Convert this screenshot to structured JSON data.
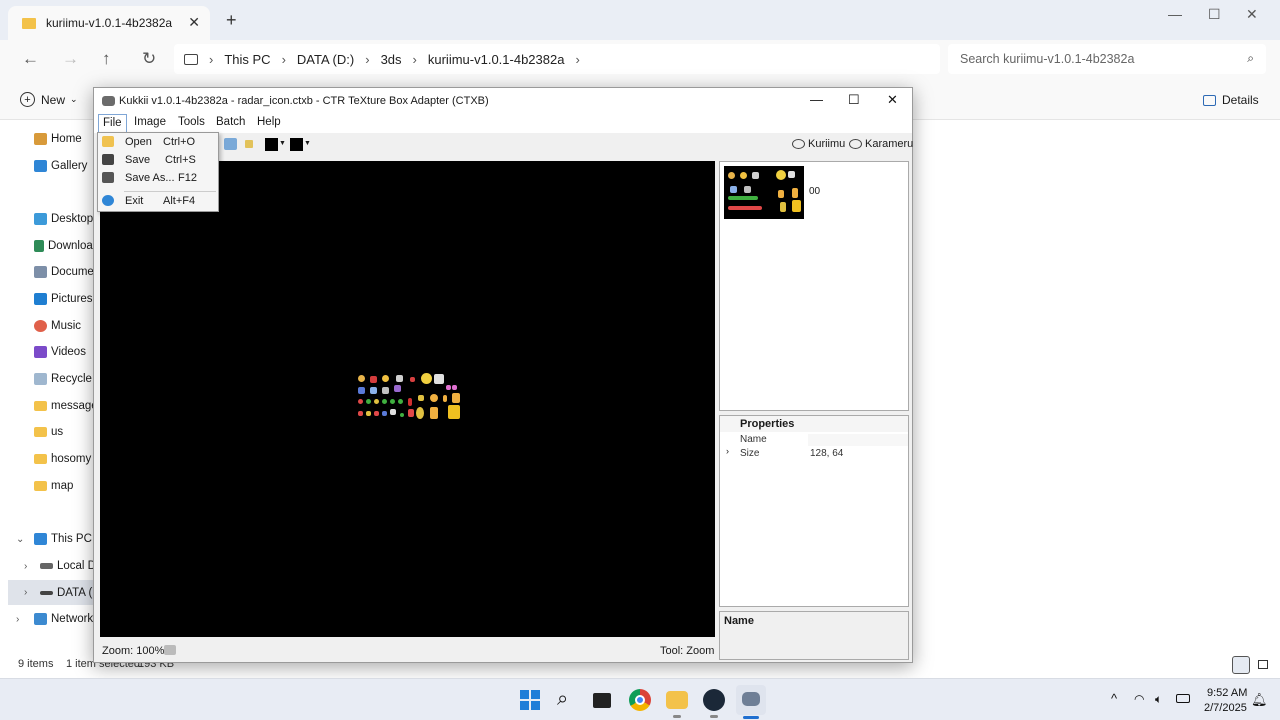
{
  "explorer": {
    "tab_title": "kuriimu-v1.0.1-4b2382a",
    "new_tab": "+",
    "window_controls": {
      "minimize": "—",
      "maximize": "☐",
      "close": "✕"
    },
    "nav_buttons": {
      "back": "←",
      "forward": "→",
      "up": "↑",
      "refresh": "↻"
    },
    "breadcrumb": [
      "This PC",
      "DATA (D:)",
      "3ds",
      "kuriimu-v1.0.1-4b2382a"
    ],
    "search_placeholder": "Search kuriimu-v1.0.1-4b2382a",
    "new_label": "New",
    "details_label": "Details",
    "sidebar": [
      {
        "label": "Home",
        "icon": "home-icon"
      },
      {
        "label": "Gallery",
        "icon": "gallery-icon"
      },
      {
        "label": "Desktop",
        "icon": "desktop-icon"
      },
      {
        "label": "Downloads",
        "icon": "download-icon"
      },
      {
        "label": "Documents",
        "icon": "documents-icon"
      },
      {
        "label": "Pictures",
        "icon": "pictures-icon"
      },
      {
        "label": "Music",
        "icon": "music-icon"
      },
      {
        "label": "Videos",
        "icon": "videos-icon"
      },
      {
        "label": "Recycle Bin",
        "icon": "recycle-bin-icon"
      },
      {
        "label": "message",
        "icon": "folder-icon"
      },
      {
        "label": "us",
        "icon": "folder-icon"
      },
      {
        "label": "hosomy",
        "icon": "folder-icon"
      },
      {
        "label": "map",
        "icon": "folder-icon"
      },
      {
        "label": "This PC",
        "icon": "pc-icon"
      },
      {
        "label": "Local Disk (C:)",
        "icon": "drive-icon"
      },
      {
        "label": "DATA (D:)",
        "icon": "drive-icon"
      },
      {
        "label": "Network",
        "icon": "network-icon"
      }
    ],
    "status": {
      "items": "9 items",
      "selected": "1 item selected",
      "size": "193 KB"
    }
  },
  "kukkii": {
    "title": "Kukkii v1.0.1-4b2382a - radar_icon.ctxb - CTR TeXture Box Adapter (CTXB)",
    "menu": [
      "File",
      "Image",
      "Tools",
      "Batch",
      "Help"
    ],
    "toolbar_links": [
      "Kuriimu",
      "Karameru"
    ],
    "thumb_index": "00",
    "properties": {
      "header": "Properties",
      "rows": [
        {
          "key": "Name",
          "value": ""
        },
        {
          "key": "Size",
          "value": "128, 64"
        }
      ]
    },
    "name_pane": "Name",
    "zoom": "Zoom: 100%",
    "tool": "Tool: Zoom"
  },
  "file_menu": [
    {
      "label": "Open",
      "shortcut": "Ctrl+O"
    },
    {
      "label": "Save",
      "shortcut": "Ctrl+S"
    },
    {
      "label": "Save As...",
      "shortcut": "F12"
    },
    {
      "label": "Exit",
      "shortcut": "Alt+F4"
    }
  ],
  "taskbar": {
    "time": "9:52 AM",
    "date": "2/7/2025"
  },
  "colors": {
    "accent": "#0a5fb4",
    "folder": "#f3c24a",
    "canvas": "#000000"
  }
}
